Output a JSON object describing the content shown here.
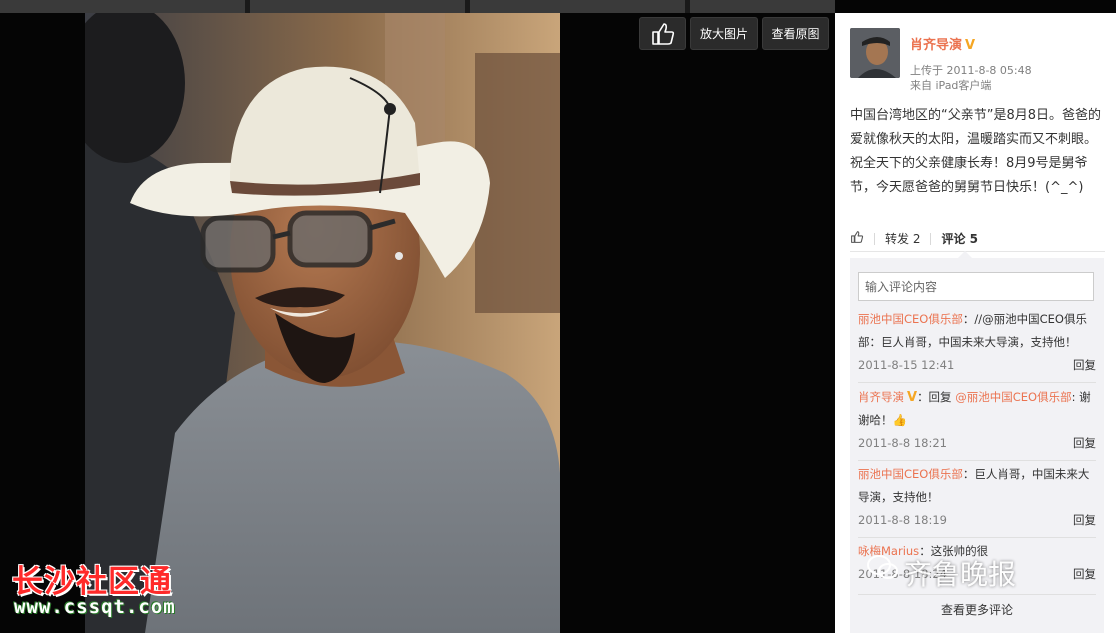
{
  "toolbar": {
    "zoom_label": "放大图片",
    "original_label": "查看原图"
  },
  "watermark": {
    "site_name": "长沙社区通",
    "site_url": "www.cssqt.com",
    "newspaper": "齐鲁晚报"
  },
  "post": {
    "author": "肖齐导演",
    "time": "上传于 2011-8-8 05:48",
    "source": "来自 iPad客户端",
    "text": "中国台湾地区的“父亲节”是8月8日。爸爸的爱就像秋天的太阳，温暖踏实而又不刺眼。 祝全天下的父亲健康长寿！8月9号是舅爷节，今天愿爸爸的舅舅节日快乐！(^_^)",
    "repost_label": "转发 2",
    "comment_label": "评论 5"
  },
  "comments": {
    "input_placeholder": "输入评论内容",
    "more_label": "查看更多评论",
    "reply_label": "回复",
    "items": [
      {
        "author": "丽池中国CEO俱乐部",
        "text": "：//@丽池中国CEO俱乐部：巨人肖哥，中国未来大导演，支持他！",
        "time": "2011-8-15 12:41"
      },
      {
        "author": "肖齐导演",
        "text": "：回复 ",
        "mention": "@丽池中国CEO俱乐部",
        "text2": ": 谢谢哈！",
        "emoji": "👍",
        "time": "2011-8-8 18:21"
      },
      {
        "author": "丽池中国CEO俱乐部",
        "text": "：巨人肖哥，中国未来大导演，支持他！",
        "time": "2011-8-8 18:19"
      },
      {
        "author": "咏梅Marius",
        "text": "：这张帅的很",
        "time": "2011-8-8 18:24"
      }
    ]
  },
  "colors": {
    "accent": "#eb7350",
    "verified": "#f5a623",
    "watermark_red": "#ff2a2a"
  }
}
